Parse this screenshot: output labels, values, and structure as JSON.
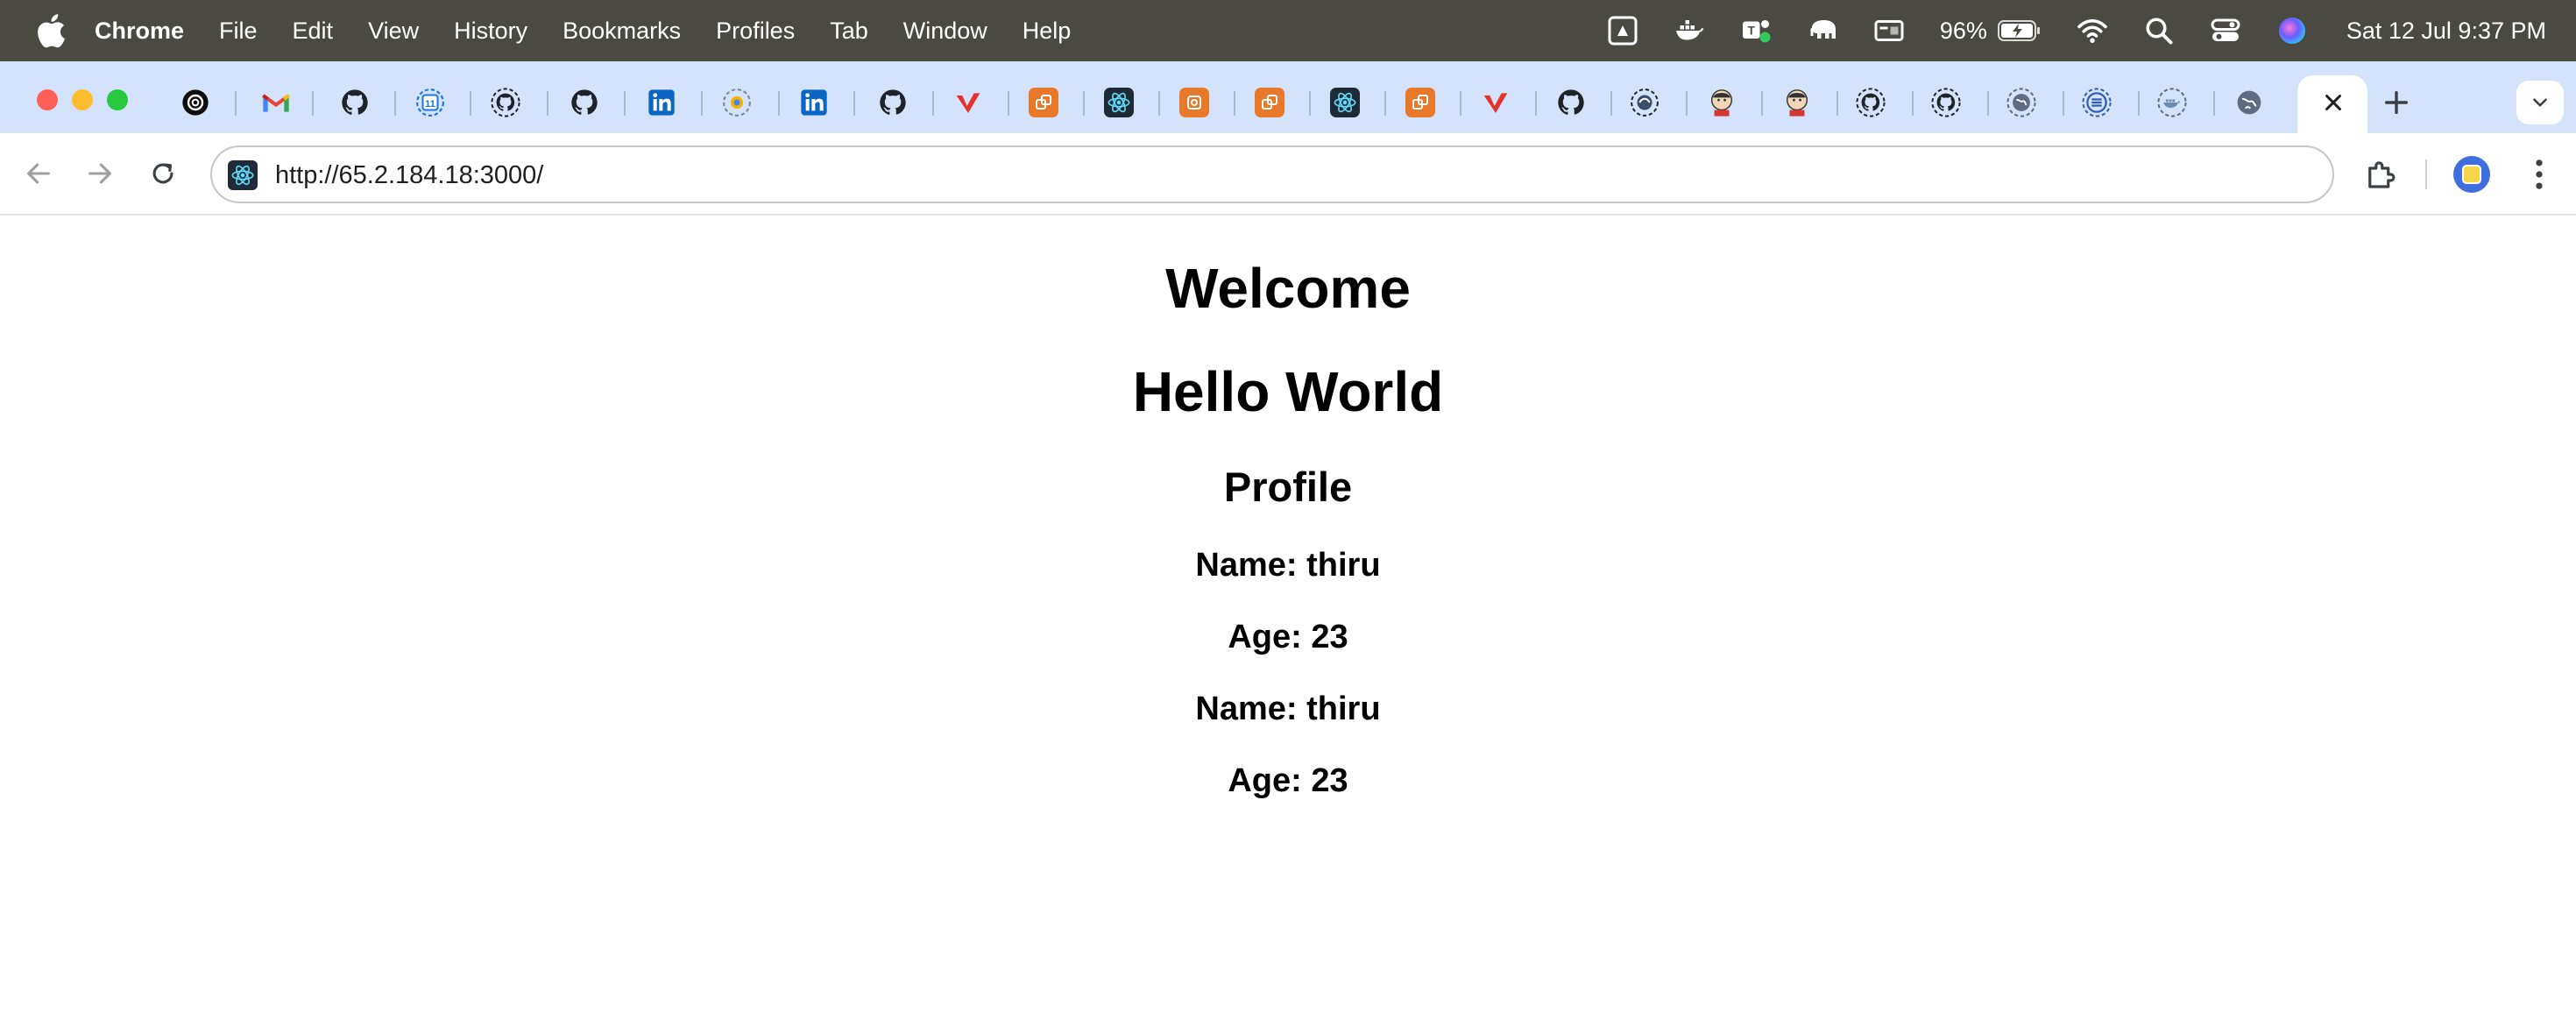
{
  "menubar": {
    "app_name": "Chrome",
    "menus": [
      "File",
      "Edit",
      "View",
      "History",
      "Bookmarks",
      "Profiles",
      "Tab",
      "Window",
      "Help"
    ],
    "battery_percent": "96%",
    "datetime": "Sat 12 Jul  9:37 PM",
    "status_icons": [
      "google-drive-icon",
      "docker-icon",
      "teams-icon",
      "elephant-icon",
      "screen-icon",
      "wifi-icon",
      "spotlight-search-icon",
      "control-center-icon",
      "siri-icon"
    ]
  },
  "tabs": {
    "favicons": [
      "openai-icon",
      "gmail-icon",
      "github-icon",
      "calendar-icon",
      "github-icon",
      "github-icon",
      "linkedin-icon",
      "loading-icon",
      "linkedin-icon",
      "github-icon",
      "vercel-icon",
      "aws-icon",
      "react-icon",
      "aws-icon",
      "aws-icon",
      "react-icon",
      "aws-icon",
      "vercel-icon",
      "github-icon",
      "loading-icon",
      "jenkins-icon",
      "jenkins-icon",
      "github-icon",
      "github-icon",
      "globe-icon",
      "list-icon",
      "docker-icon",
      "globe-icon"
    ],
    "active_tab_close_icon": "close-icon",
    "new_tab_icon": "plus-icon",
    "tab_search_icon": "chevron-down-icon",
    "colors": {
      "strip_bg": "#d4e3fb",
      "github": "#1f2328",
      "linkedin": "#0a66c2",
      "aws": "#e8792b",
      "react": "#1e2a35",
      "vercel_red": "#e5322d"
    }
  },
  "toolbar": {
    "url": "http://65.2.184.18:3000/",
    "back_icon": "arrow-left-icon",
    "forward_icon": "arrow-right-icon",
    "reload_icon": "reload-icon",
    "extensions_icon": "puzzle-icon",
    "profile_icon": "avatar",
    "menu_icon": "kebab-menu-icon"
  },
  "page": {
    "title": "Welcome",
    "heading": "Hello World",
    "profile_title": "Profile",
    "entries": [
      {
        "name_line": "Name: thiru",
        "age_line": "Age: 23"
      },
      {
        "name_line": "Name: thiru",
        "age_line": "Age: 23"
      }
    ]
  }
}
